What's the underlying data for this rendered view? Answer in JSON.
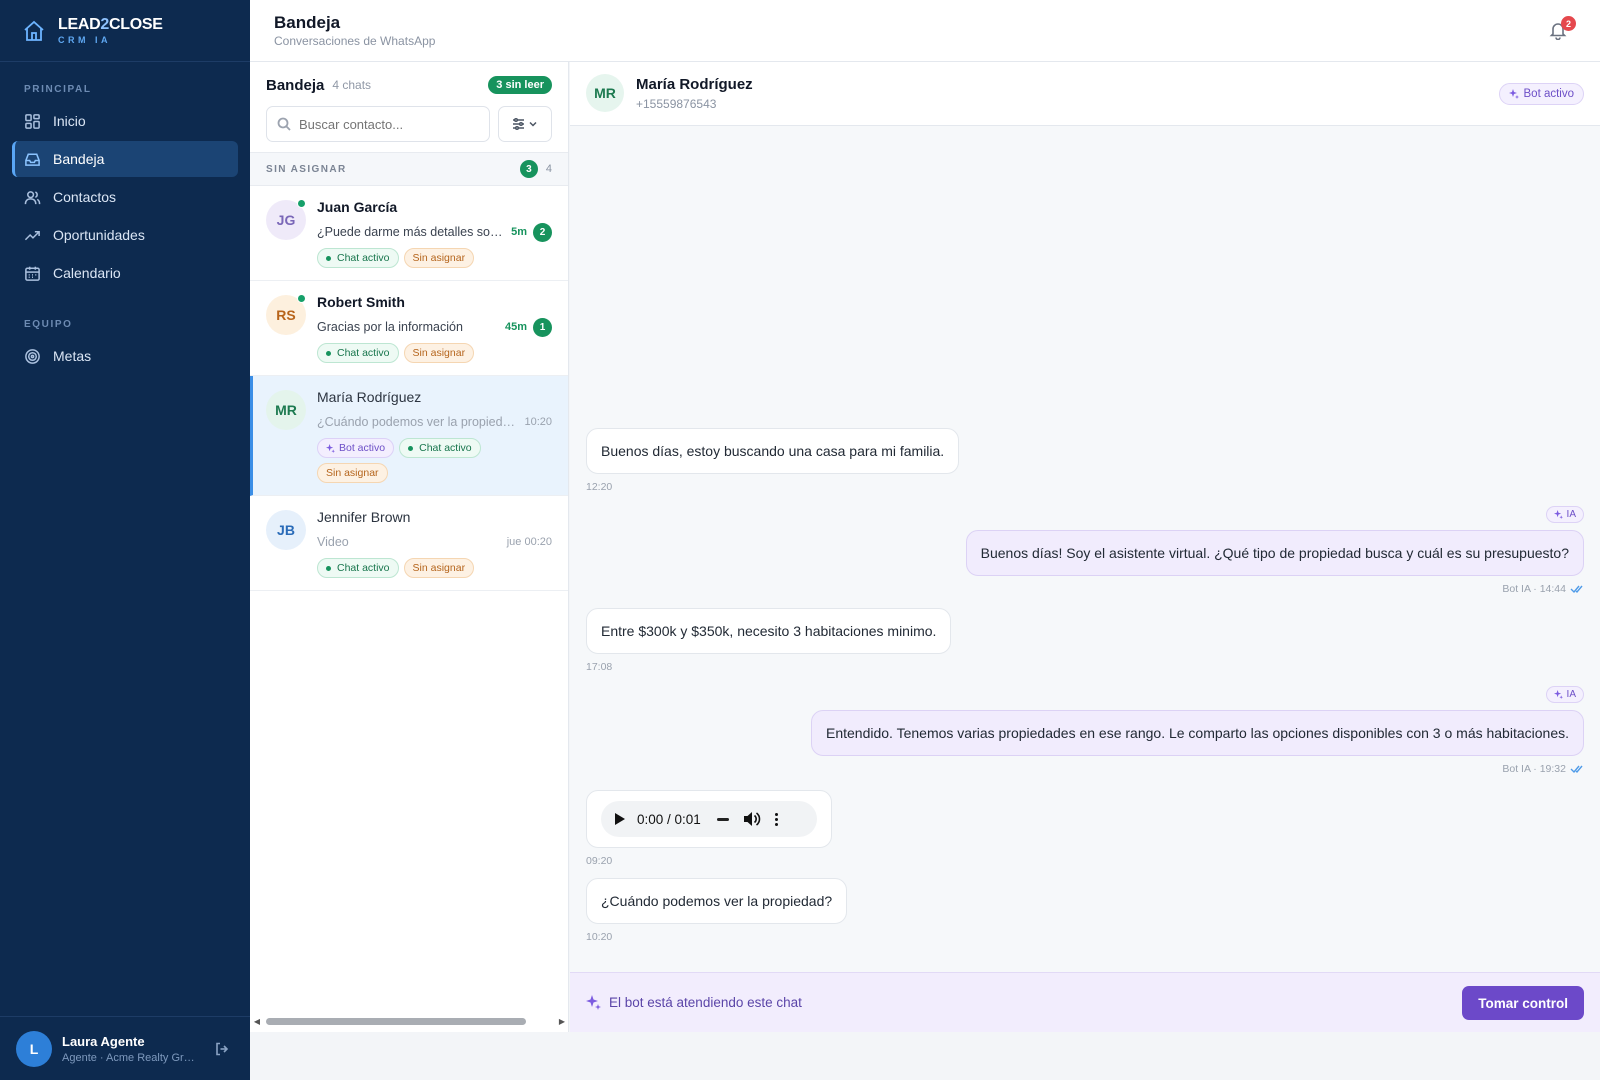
{
  "brand": {
    "name_part1": "LEAD",
    "name_accent": "2",
    "name_part2": "CLOSE",
    "tagline": "CRM IA"
  },
  "sidebar": {
    "section_principal": "PRINCIPAL",
    "section_team": "EQUIPO",
    "items": [
      {
        "label": "Inicio",
        "icon": "grid-icon"
      },
      {
        "label": "Bandeja",
        "icon": "inbox-icon",
        "active": true
      },
      {
        "label": "Contactos",
        "icon": "users-icon"
      },
      {
        "label": "Oportunidades",
        "icon": "trend-icon"
      },
      {
        "label": "Calendario",
        "icon": "calendar-icon"
      }
    ],
    "team_items": [
      {
        "label": "Metas",
        "icon": "target-icon"
      }
    ],
    "user": {
      "initial": "L",
      "name": "Laura Agente",
      "role": "Agente · Acme Realty Group"
    }
  },
  "header": {
    "title": "Bandeja",
    "subtitle": "Conversaciones de WhatsApp",
    "notifications": "2"
  },
  "chat_list": {
    "title": "Bandeja",
    "count": "4 chats",
    "unread": "3 sin leer",
    "search_placeholder": "Buscar contacto...",
    "group_label": "SIN ASIGNAR",
    "group_unread": "3",
    "group_count": "4",
    "chats": [
      {
        "initials": "JG",
        "name": "Juan García",
        "preview": "¿Puede darme más detalles sobre la propiedad?",
        "time": "5m",
        "badge": "2",
        "tag_active": "Chat activo",
        "tag_unassigned": "Sin asignar"
      },
      {
        "initials": "RS",
        "name": "Robert Smith",
        "preview": "Gracias por la información",
        "time": "45m",
        "badge": "1",
        "tag_active": "Chat activo",
        "tag_unassigned": "Sin asignar"
      },
      {
        "initials": "MR",
        "name": "María Rodríguez",
        "preview": "¿Cuándo podemos ver la propiedad?",
        "time": "10:20",
        "tag_bot": "Bot activo",
        "tag_active": "Chat activo",
        "tag_unassigned": "Sin asignar"
      },
      {
        "initials": "JB",
        "name": "Jennifer Brown",
        "preview": "Video",
        "time": "jue 00:20",
        "tag_active": "Chat activo",
        "tag_unassigned": "Sin asignar"
      }
    ]
  },
  "conversation": {
    "initials": "MR",
    "name": "María Rodríguez",
    "phone": "+15559876543",
    "bot_status": "Bot activo",
    "ia_label": "IA",
    "messages": [
      {
        "text": "Buenos días, estoy buscando una casa para mi familia.",
        "time": "12:20"
      },
      {
        "text": "Buenos días! Soy el asistente virtual. ¿Qué tipo de propiedad busca y cuál es su presupuesto?",
        "meta": "Bot IA · 14:44"
      },
      {
        "text": "Entre $300k y $350k, necesito 3 habitaciones minimo.",
        "time": "17:08"
      },
      {
        "text": "Entendido. Tenemos varias propiedades en ese rango. Le comparto las opciones disponibles con 3 o más habitaciones.",
        "meta": "Bot IA · 19:32"
      },
      {
        "audio_time": "0:00 / 0:01",
        "time": "09:20"
      },
      {
        "text": "¿Cuándo podemos ver la propiedad?",
        "time": "10:20"
      }
    ],
    "botbar_text": "El bot está atendiendo este chat",
    "take_control": "Tomar control"
  }
}
